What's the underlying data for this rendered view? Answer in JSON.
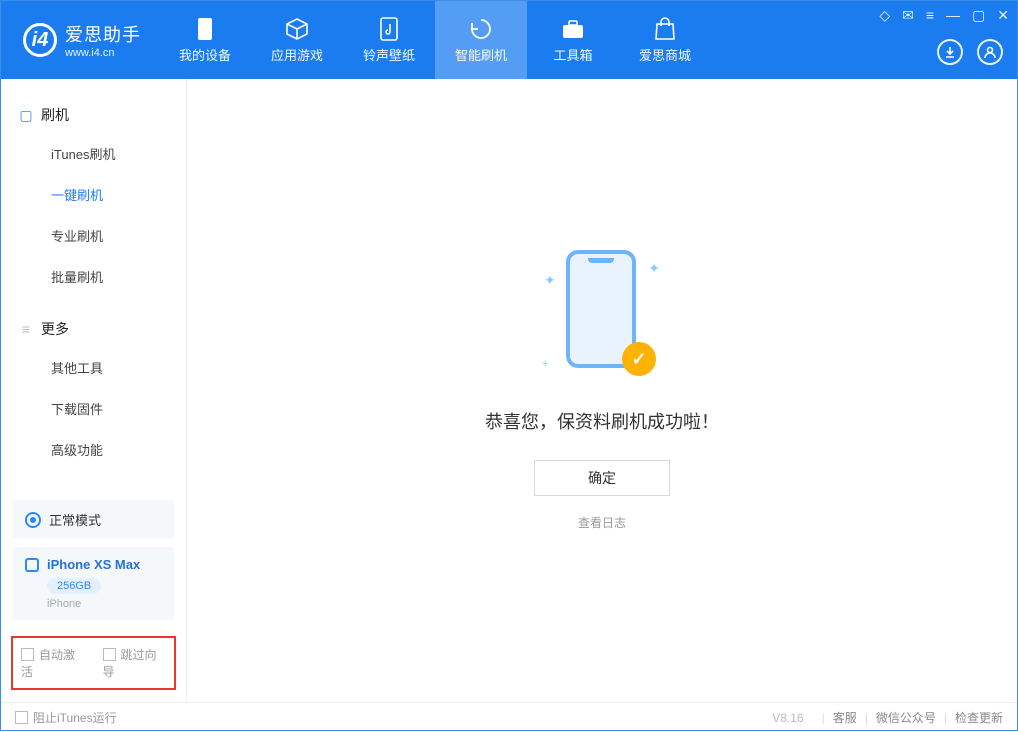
{
  "app": {
    "title": "爱思助手",
    "subtitle": "www.i4.cn"
  },
  "nav": {
    "device": "我的设备",
    "apps": "应用游戏",
    "ringtone": "铃声壁纸",
    "flash": "智能刷机",
    "toolbox": "工具箱",
    "store": "爱思商城"
  },
  "sidebar": {
    "group_flash": "刷机",
    "items_flash": {
      "itunes": "iTunes刷机",
      "oneclick": "一键刷机",
      "pro": "专业刷机",
      "batch": "批量刷机"
    },
    "group_more": "更多",
    "items_more": {
      "other": "其他工具",
      "firmware": "下载固件",
      "advanced": "高级功能"
    },
    "mode": "正常模式",
    "device_name": "iPhone XS Max",
    "device_capacity": "256GB",
    "device_type": "iPhone",
    "cb_autoactivate": "自动激活",
    "cb_skipguide": "跳过向导"
  },
  "main": {
    "success": "恭喜您，保资料刷机成功啦！",
    "ok": "确定",
    "viewlog": "查看日志"
  },
  "footer": {
    "block_itunes": "阻止iTunes运行",
    "version": "V8.16",
    "support": "客服",
    "wechat": "微信公众号",
    "update": "检查更新"
  }
}
